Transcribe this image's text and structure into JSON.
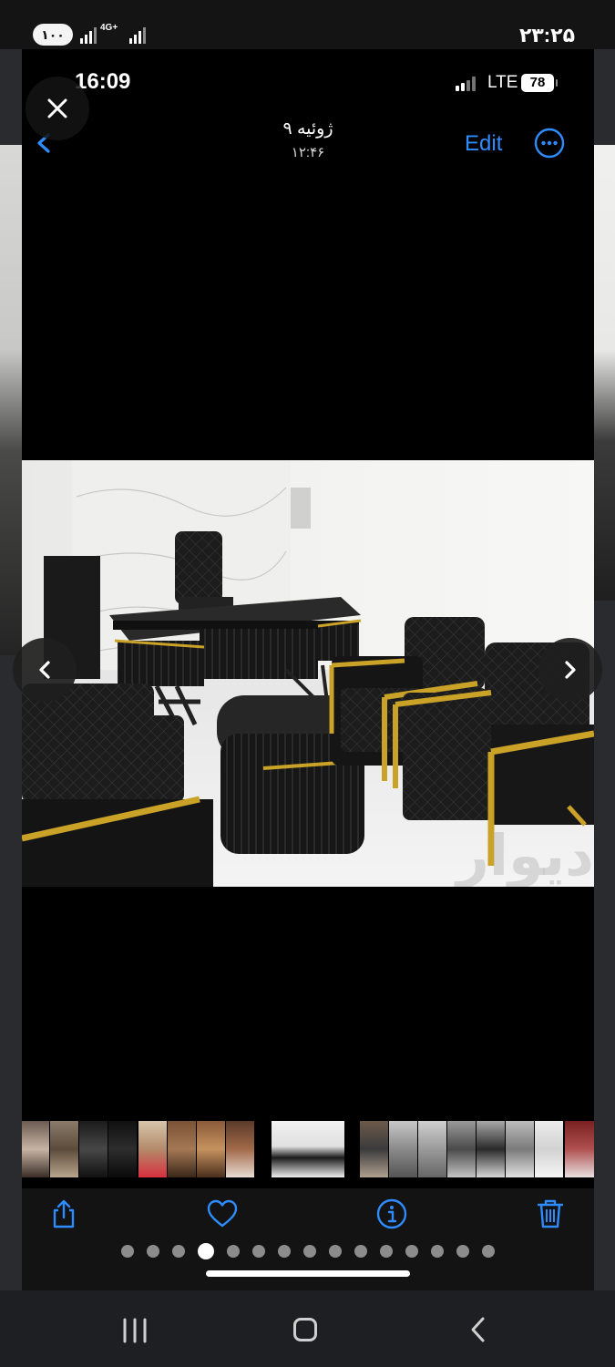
{
  "android_status": {
    "battery": "۱۰۰",
    "network": "4G+",
    "clock": "۲۳:۲۵"
  },
  "ios_status": {
    "time": "16:09",
    "carrier": "LTE",
    "battery": "78"
  },
  "photo_header": {
    "date": "۹ ژوئیه",
    "time": "۱۲:۴۶",
    "edit_label": "Edit"
  },
  "watermark": "دیوار",
  "page_indicator": {
    "count": 15,
    "active_index": 3
  },
  "icons": {
    "close": "close-icon",
    "back": "chevron-left-icon",
    "more": "more-icon",
    "share": "share-icon",
    "favorite": "heart-icon",
    "info": "info-icon",
    "delete": "trash-icon",
    "prev": "chevron-left-icon",
    "next": "chevron-right-icon"
  },
  "colors": {
    "accent": "#2f8cff",
    "background": "#000000",
    "gold_trim": "#c9a227"
  }
}
